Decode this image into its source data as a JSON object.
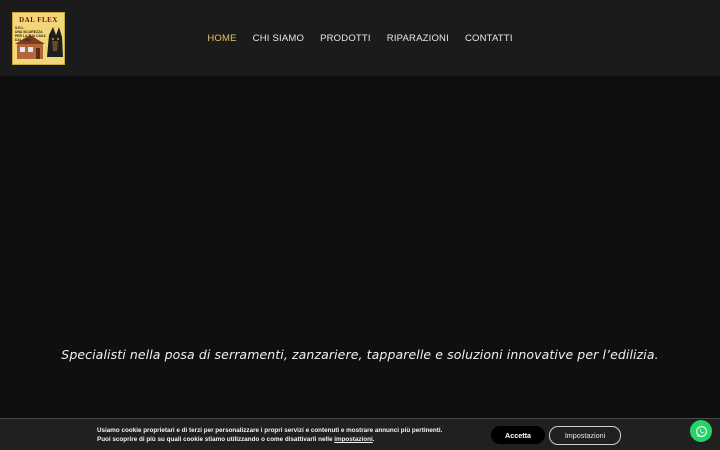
{
  "logo": {
    "brand": "DAL FLEX",
    "suffix": "S.R.L.",
    "tagline": "UNA SICUREZZA PER LA TUA CASA DAL 1989"
  },
  "nav": {
    "items": [
      {
        "label": "HOME",
        "active": true
      },
      {
        "label": "CHI SIAMO",
        "active": false
      },
      {
        "label": "PRODOTTI",
        "active": false
      },
      {
        "label": "RIPARAZIONI",
        "active": false
      },
      {
        "label": "CONTATTI",
        "active": false
      }
    ]
  },
  "hero": {
    "tagline": "Specialisti nella posa di serramenti, zanzariere, tapparelle e soluzioni innovative per l’edilizia."
  },
  "cookie_banner": {
    "line1": "Usiamo cookie proprietari e di terzi per personalizzare i propri servizi e contenuti e mostrare annunci più pertinenti.",
    "line2_before": "Puoi scoprire di più su quali cookie stiamo utilizzando o come disattivarli nelle ",
    "line2_link": "impostazioni",
    "line2_after": ".",
    "accept_label": "Accetta",
    "settings_label": "Impostazioni"
  },
  "colors": {
    "accent": "#e6c36a",
    "header_bg": "#1b1b1b",
    "page_bg": "#0f0f0f",
    "whatsapp": "#25d366"
  },
  "icons": {
    "whatsapp": "whatsapp-icon"
  }
}
